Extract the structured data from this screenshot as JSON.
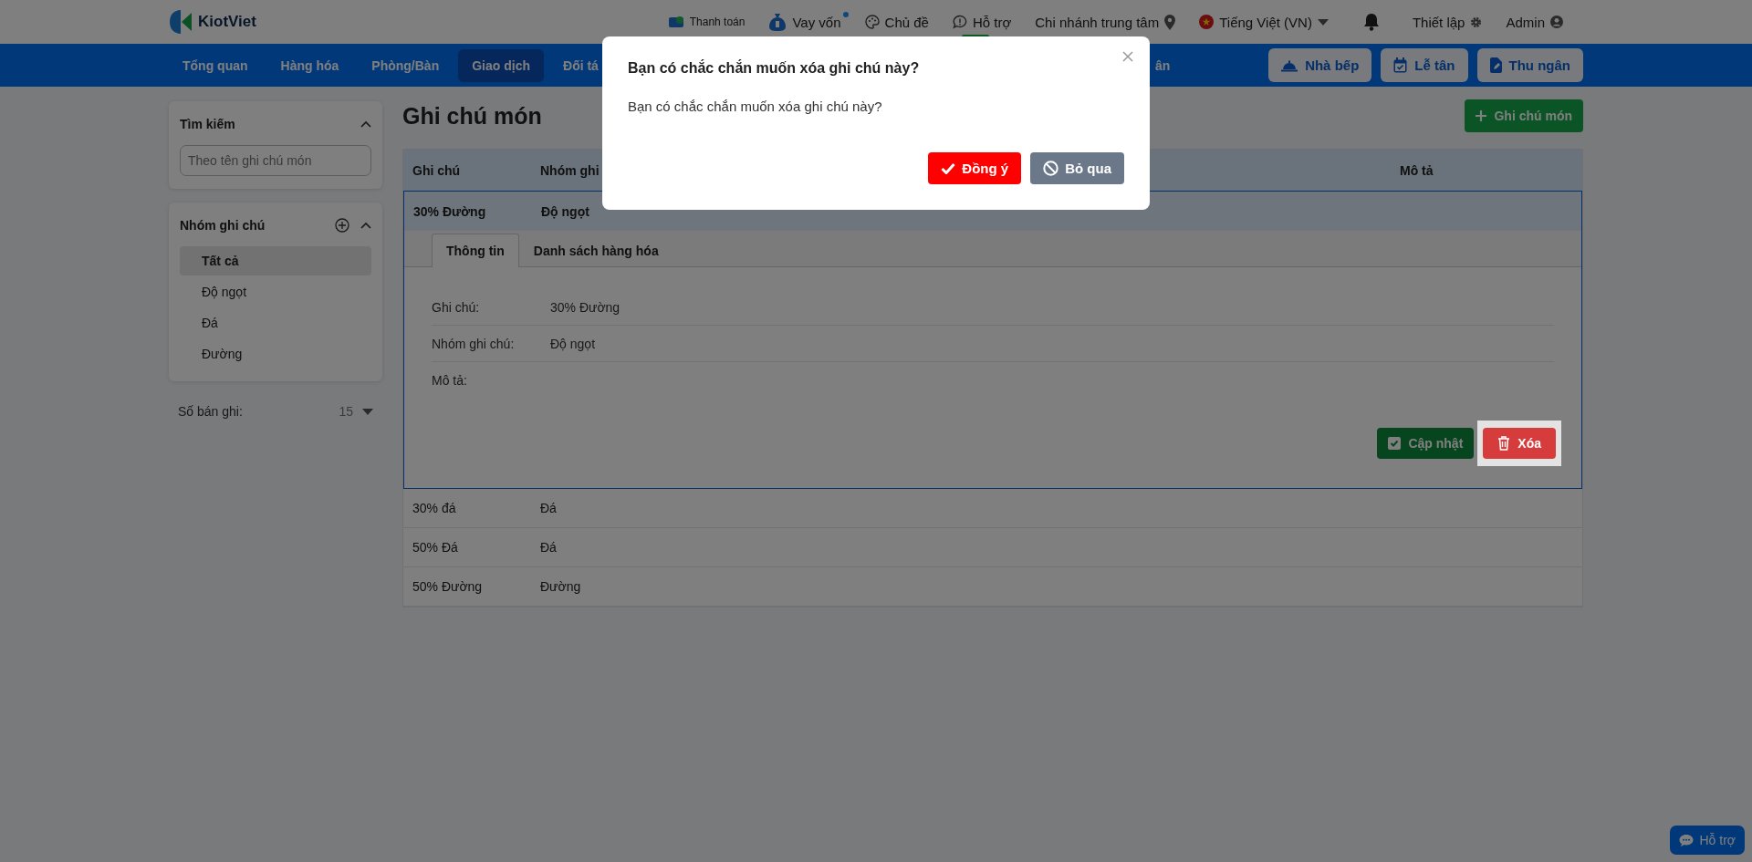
{
  "header": {
    "logo": "KiotViet",
    "links": [
      {
        "kind": "payment",
        "label": "Thanh toán"
      },
      {
        "kind": "loan",
        "label": "Vay vốn",
        "notification": true
      },
      {
        "kind": "theme",
        "label": "Chủ đề"
      },
      {
        "kind": "support",
        "label": "Hỗ trợ",
        "badge": true
      },
      {
        "kind": "branch",
        "label": "Chi nhánh trung tâm"
      },
      {
        "kind": "language",
        "label": "Tiếng Việt (VN)"
      },
      {
        "kind": "bell"
      },
      {
        "kind": "settings",
        "label": "Thiết lập"
      },
      {
        "kind": "user",
        "label": "Admin"
      }
    ]
  },
  "nav": {
    "items": [
      {
        "label": "Tổng quan",
        "selected": false
      },
      {
        "label": "Hàng hóa",
        "selected": false
      },
      {
        "label": "Phòng/Bàn",
        "selected": false
      },
      {
        "label": "Giao dịch",
        "selected": true
      },
      {
        "label": "Đối tá",
        "selected": false
      }
    ],
    "item_fragment": "ân",
    "buttons": [
      {
        "kind": "kitchen",
        "label": "Nhà bếp"
      },
      {
        "kind": "reception",
        "label": "Lễ tân"
      },
      {
        "kind": "cashier",
        "label": "Thu ngân"
      }
    ]
  },
  "sidebar": {
    "search": {
      "title": "Tìm kiếm",
      "expanded": true,
      "placeholder": "Theo tên ghi chú món"
    },
    "groups": {
      "title": "Nhóm ghi chú",
      "expanded": true,
      "items": [
        {
          "label": "Tất cả",
          "selected": true
        },
        {
          "label": "Độ ngọt",
          "selected": false
        },
        {
          "label": "Đá",
          "selected": false
        },
        {
          "label": "Đường",
          "selected": false
        }
      ]
    },
    "page_size": {
      "label": "Số bán ghi:",
      "value": "15"
    }
  },
  "main": {
    "title": "Ghi chú món",
    "add_button": "Ghi chú món",
    "table": {
      "columns": [
        "Ghi chú",
        "Nhóm ghi",
        "Mô tả"
      ],
      "rows": [
        {
          "cells": [
            "30% Đường",
            "Độ ngọt"
          ],
          "selected": true,
          "expanded": true,
          "details": {
            "tabs": [
              {
                "label": "Thông tin",
                "selected": true
              },
              {
                "label": "Danh sách hàng hóa",
                "selected": false
              }
            ],
            "fields": [
              {
                "label": "Ghi chú:",
                "value": "30% Đường"
              },
              {
                "label": "Nhóm ghi chú:",
                "value": "Độ ngọt"
              },
              {
                "label": "Mô tả:"
              }
            ],
            "buttons": [
              {
                "kind": "update",
                "label": "Cập nhật",
                "focused": false
              },
              {
                "kind": "delete",
                "label": "Xóa",
                "focused": true
              }
            ]
          }
        },
        {
          "cells": [
            "30% đá",
            "Đá"
          ],
          "selected": false,
          "expanded": false
        },
        {
          "cells": [
            "50% Đá",
            "Đá"
          ],
          "selected": false,
          "expanded": false
        },
        {
          "cells": [
            "50% Đường",
            "Đường"
          ],
          "selected": false,
          "expanded": false
        }
      ]
    }
  },
  "dialog": {
    "title": "Bạn có chắc chắn muốn xóa ghi chú này?",
    "message": "Bạn có chắc chắn muốn xóa ghi chú này?",
    "buttons": [
      {
        "kind": "confirm",
        "label": "Đồng ý"
      },
      {
        "kind": "cancel",
        "label": "Bỏ qua"
      }
    ]
  },
  "help_button": "Hỗ trợ"
}
